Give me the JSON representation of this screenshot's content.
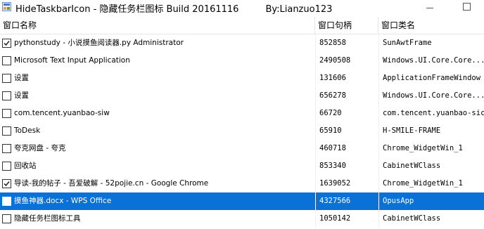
{
  "window": {
    "title": "HideTaskbarIcon - 隐藏任务栏图标 Build 20161116",
    "author": "By:Lianzuo123"
  },
  "columns": [
    "窗口名称",
    "窗口句柄",
    "窗口类名"
  ],
  "rows": [
    {
      "name": "pythonstudy - 小说摸鱼阅读器.py Administrator",
      "handle": "852858",
      "class": "SunAwtFrame",
      "checked": true,
      "selected": false
    },
    {
      "name": "Microsoft Text Input Application",
      "handle": "2490508",
      "class": "Windows.UI.Core.Core...",
      "checked": false,
      "selected": false
    },
    {
      "name": "设置",
      "handle": "131606",
      "class": "ApplicationFrameWindow",
      "checked": false,
      "selected": false
    },
    {
      "name": "设置",
      "handle": "656278",
      "class": "Windows.UI.Core.Core...",
      "checked": false,
      "selected": false
    },
    {
      "name": "com.tencent.yuanbao-siw",
      "handle": "66720",
      "class": "com.tencent.yuanbao-sic",
      "checked": false,
      "selected": false
    },
    {
      "name": "ToDesk",
      "handle": "65910",
      "class": "H-SMILE-FRAME",
      "checked": false,
      "selected": false
    },
    {
      "name": "夸克网盘 - 夸克",
      "handle": "460718",
      "class": "Chrome_WidgetWin_1",
      "checked": false,
      "selected": false
    },
    {
      "name": "回收站",
      "handle": "853340",
      "class": "CabinetWClass",
      "checked": false,
      "selected": false
    },
    {
      "name": "导读-我的帖子 - 吾爱破解 - 52pojie.cn - Google Chrome",
      "handle": "1639052",
      "class": "Chrome_WidgetWin_1",
      "checked": true,
      "selected": false
    },
    {
      "name": "摸鱼神器.docx - WPS Office",
      "handle": "4327566",
      "class": "OpusApp",
      "checked": false,
      "selected": true
    },
    {
      "name": "隐藏任务栏图标工具",
      "handle": "1050142",
      "class": "CabinetWClass",
      "checked": false,
      "selected": false
    }
  ]
}
